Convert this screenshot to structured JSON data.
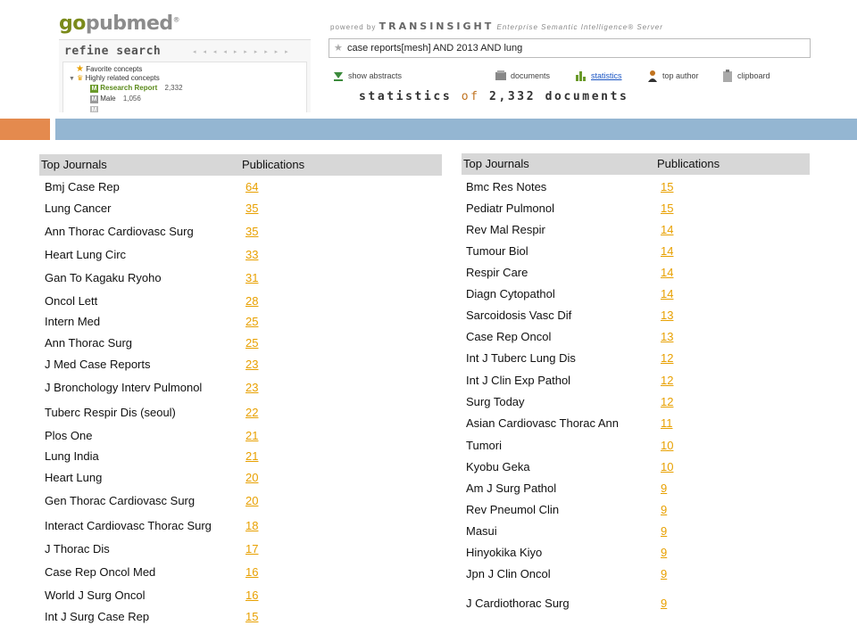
{
  "header": {
    "logo_go": "go",
    "logo_pm": "pubmed",
    "logo_mark": "®",
    "powered_prefix": "powered by",
    "powered_brand": "TRANSINSIGHT",
    "powered_suffix": "Enterprise Semantic Intelligence® Server"
  },
  "refine": {
    "title": "refine search",
    "arrows": "◂ ◂ ◂ ◂ ▸ ▸ ▸ ▸ ▸ ▸",
    "favorite": "Favorite concepts",
    "related": "Highly related concepts",
    "research_report": "Research Report",
    "research_report_count": "2,332",
    "male": "Male",
    "male_count": "1,056"
  },
  "search": {
    "query": "case reports[mesh] AND 2013 AND lung"
  },
  "toolbar": {
    "show_abstracts": "show abstracts",
    "documents": "documents",
    "statistics": "statistics",
    "top_author": "top author",
    "clipboard": "clipboard"
  },
  "stats": {
    "prefix": "statistics",
    "of": "of",
    "count": "2,332",
    "suffix": "documents"
  },
  "left_table": {
    "header_journal": "Top Journals",
    "header_pubs": "Publications",
    "rows": [
      {
        "journal": "Bmj Case Rep",
        "pubs": "64"
      },
      {
        "journal": "Lung Cancer",
        "pubs": "35"
      },
      {
        "journal": "Ann Thorac Cardiovasc Surg",
        "pubs": "35"
      },
      {
        "journal": "Heart Lung Circ",
        "pubs": "33"
      },
      {
        "journal": "Gan To Kagaku Ryoho",
        "pubs": "31"
      },
      {
        "journal": "Oncol Lett",
        "pubs": "28"
      },
      {
        "journal": "Intern Med",
        "pubs": "25"
      },
      {
        "journal": "Ann Thorac Surg",
        "pubs": "25"
      },
      {
        "journal": "J Med Case Reports",
        "pubs": "23"
      },
      {
        "journal": "J Bronchology Interv Pulmonol",
        "pubs": "23"
      },
      {
        "journal": "Tuberc Respir Dis (seoul)",
        "pubs": "22"
      },
      {
        "journal": "Plos One",
        "pubs": "21"
      },
      {
        "journal": "Lung India",
        "pubs": "21"
      },
      {
        "journal": "Heart Lung",
        "pubs": "20"
      },
      {
        "journal": "Gen Thorac Cardiovasc Surg",
        "pubs": "20"
      },
      {
        "journal": "Interact Cardiovasc Thorac Surg",
        "pubs": "18"
      },
      {
        "journal": "J Thorac Dis",
        "pubs": "17"
      },
      {
        "journal": "Case Rep Oncol Med",
        "pubs": "16"
      },
      {
        "journal": "World J Surg Oncol",
        "pubs": "16"
      },
      {
        "journal": "Int J Surg Case Rep",
        "pubs": "15"
      }
    ]
  },
  "right_table": {
    "header_journal": "Top Journals",
    "header_pubs": "Publications",
    "rows": [
      {
        "journal": "Bmc Res Notes",
        "pubs": "15"
      },
      {
        "journal": "Pediatr Pulmonol",
        "pubs": "15"
      },
      {
        "journal": "Rev Mal Respir",
        "pubs": "14"
      },
      {
        "journal": "Tumour Biol",
        "pubs": "14"
      },
      {
        "journal": "Respir Care",
        "pubs": "14"
      },
      {
        "journal": "Diagn Cytopathol",
        "pubs": "14"
      },
      {
        "journal": "Sarcoidosis Vasc Dif",
        "pubs": "13"
      },
      {
        "journal": "Case Rep Oncol",
        "pubs": "13"
      },
      {
        "journal": "Int J Tuberc Lung Dis",
        "pubs": "12"
      },
      {
        "journal": "Int J Clin Exp Pathol",
        "pubs": "12"
      },
      {
        "journal": "Surg Today",
        "pubs": "12"
      },
      {
        "journal": "Asian Cardiovasc Thorac Ann",
        "pubs": "11"
      },
      {
        "journal": "Tumori",
        "pubs": "10"
      },
      {
        "journal": "Kyobu Geka",
        "pubs": "10"
      },
      {
        "journal": "Am J Surg Pathol",
        "pubs": "9"
      },
      {
        "journal": "Rev Pneumol Clin",
        "pubs": "9"
      },
      {
        "journal": "Masui",
        "pubs": "9"
      },
      {
        "journal": "Hinyokika Kiyo",
        "pubs": "9"
      },
      {
        "journal": "Jpn J Clin Oncol",
        "pubs": "9"
      },
      {
        "journal": "J Cardiothorac Surg",
        "pubs": "9"
      }
    ]
  },
  "colors": {
    "accent_orange": "#e48a4e",
    "accent_blue": "#94b6d2",
    "link": "#e8a000",
    "header_bg": "#d7d7d7"
  }
}
